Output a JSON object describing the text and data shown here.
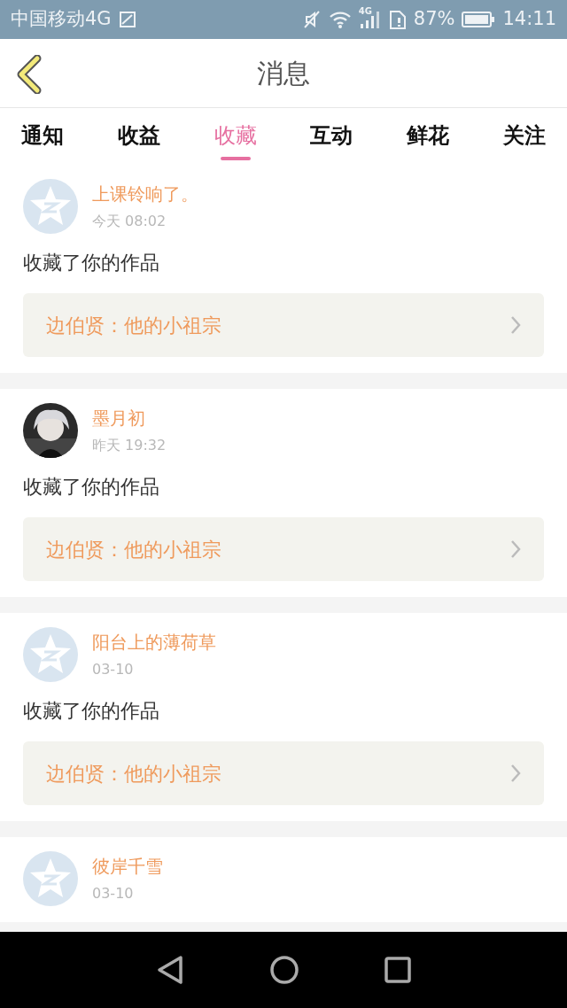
{
  "status_bar": {
    "carrier": "中国移动4G",
    "network": "4G",
    "battery": "87%",
    "time": "14:11"
  },
  "header": {
    "title": "消息"
  },
  "tabs": [
    {
      "label": "通知",
      "selected": false
    },
    {
      "label": "收益",
      "selected": false
    },
    {
      "label": "收藏",
      "selected": true
    },
    {
      "label": "互动",
      "selected": false
    },
    {
      "label": "鲜花",
      "selected": false
    },
    {
      "label": "关注",
      "selected": false
    }
  ],
  "messages": [
    {
      "avatar": {
        "kind": "default"
      },
      "name": "上课铃响了。",
      "time": "今天 08:02",
      "text": "收藏了你的作品",
      "work": "边伯贤：他的小祖宗"
    },
    {
      "name": "墨月初",
      "time": "昨天 19:32",
      "text": "收藏了你的作品",
      "work": "边伯贤：他的小祖宗"
    },
    {
      "avatar": {
        "kind": "default"
      },
      "name": "阳台上的薄荷草",
      "time": "03-10",
      "text": "收藏了你的作品",
      "work": "边伯贤：他的小祖宗"
    },
    {
      "avatar": {
        "kind": "default"
      },
      "name": "彼岸千雪",
      "time": "03-10"
    }
  ]
}
